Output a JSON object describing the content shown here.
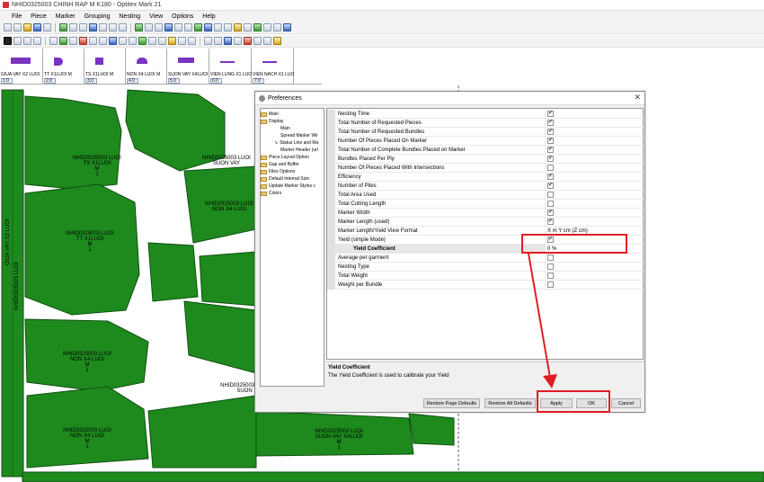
{
  "window": {
    "title": "NHID0325003 CHINH RAP  M K180 - Optitex Mark 21"
  },
  "menu": [
    "File",
    "Piece",
    "Marker",
    "Grouping",
    "Nesting",
    "View",
    "Options",
    "Help"
  ],
  "pieces": [
    {
      "label": "GIUA VAY X2 LUOI",
      "qty": "1.0"
    },
    {
      "label": "TT X1LUOI M",
      "qty": "2.0"
    },
    {
      "label": "TS  X1LUOI M",
      "qty": "3.0"
    },
    {
      "label": "NON X4 LUOI M",
      "qty": "4.0"
    },
    {
      "label": "SUON VAY X4LUOI",
      "qty": "5.0"
    },
    {
      "label": "VIEN LUNG X1 LUO",
      "qty": "6.0"
    },
    {
      "label": "VIEN NACH X1 LUO",
      "qty": "7.0"
    }
  ],
  "canvas_labels": [
    {
      "l1": "NHID0325003 LUOI",
      "l2": "TS  X1LUOI",
      "l3": "M",
      "l4": "1"
    },
    {
      "l1": "NHID0325003 LUOI",
      "l2": "SUON VAY",
      "l3": "M",
      "l4": ""
    },
    {
      "l1": "NHID0325003 LUOI",
      "l2": "NON X4 LUOI",
      "l3": "M",
      "l4": ""
    },
    {
      "l1": "NHID0325003 LUOI",
      "l2": "TT X1LUOI",
      "l3": "M",
      "l4": "1"
    },
    {
      "l1": "NHID0325003 LUOI",
      "l2": "NON X4 LUOI",
      "l3": "M",
      "l4": "1"
    },
    {
      "l1": "NHID0325003 LUOI",
      "l2": "NON X4 LUOI",
      "l3": "M",
      "l4": "1"
    },
    {
      "l1": "NHID0325003 LUOI",
      "l2": "SUON VAY X4LUOI",
      "l3": "M",
      "l4": "1"
    },
    {
      "l1": "NHID0325003 LUOI",
      "l2": "SUON",
      "l3": "",
      "l4": ""
    }
  ],
  "vertical_labels": [
    "GIUA VAY X2 LUOI",
    "NHID0325003 LUOI"
  ],
  "dialog": {
    "title": "Preferences",
    "tree": [
      {
        "label": "Main",
        "level": 0
      },
      {
        "label": "Display",
        "level": 0
      },
      {
        "label": "Main",
        "level": 1
      },
      {
        "label": "Spread Marker Wir",
        "level": 1
      },
      {
        "label": "Status Line and Ma",
        "level": 1,
        "selected": true
      },
      {
        "label": "Marker Header (url",
        "level": 1
      },
      {
        "label": "Piece Layout Option",
        "level": 0
      },
      {
        "label": "Gap and Buffer",
        "level": 0
      },
      {
        "label": "Files Options",
        "level": 0
      },
      {
        "label": "Default Internal Size",
        "level": 0
      },
      {
        "label": "Update Marker Styles c",
        "level": 0
      },
      {
        "label": "Colors",
        "level": 0
      }
    ],
    "properties": [
      {
        "name": "Nesting Time",
        "checked": true
      },
      {
        "name": "Total Number of Requested Pieces",
        "checked": true
      },
      {
        "name": "Total Number of Requested Bundles",
        "checked": true
      },
      {
        "name": "Number Of Pieces Placed On Marker",
        "checked": true
      },
      {
        "name": "Total Number of Complete Bundles Placed on Marker",
        "checked": true
      },
      {
        "name": "Bundles Placed Per Ply",
        "checked": true
      },
      {
        "name": "Number Of Pieces Placed With Intersections",
        "checked": false
      },
      {
        "name": "Efficiency",
        "checked": true
      },
      {
        "name": "Number of Plies",
        "checked": true
      },
      {
        "name": "Total Area Used",
        "checked": false
      },
      {
        "name": "Total Cutting Length",
        "checked": false
      },
      {
        "name": "Marker Width",
        "checked": true
      },
      {
        "name": "Marker Length (used)",
        "checked": true
      },
      {
        "name": "Marker Length/Yield View Format",
        "value": "X m Y cm (Z cm)"
      },
      {
        "name": "Yield (simple Mode)",
        "checked": true
      },
      {
        "name": "Yield Coefficient",
        "value": "0 %",
        "sub": true
      },
      {
        "name": "Average per garment",
        "checked": false
      },
      {
        "name": "Nesting Type",
        "checked": false
      },
      {
        "name": "Total Weight",
        "checked": false
      },
      {
        "name": "Weight per Bundle",
        "checked": false
      }
    ],
    "description_title": "Yield Coefficient",
    "description_text": "The Yield Coefficient is used to calibrate your Yield",
    "buttons": {
      "restore_page": "Restore Page Defaults",
      "restore_all": "Restore All Defaults",
      "apply": "Apply",
      "ok": "OK",
      "cancel": "Cancel"
    }
  },
  "colors": {
    "piece_fill": "#1e8a1e",
    "piece_stroke": "#0f4f0f",
    "highlight": "#e21c24",
    "thumb": "#7b33c3"
  }
}
